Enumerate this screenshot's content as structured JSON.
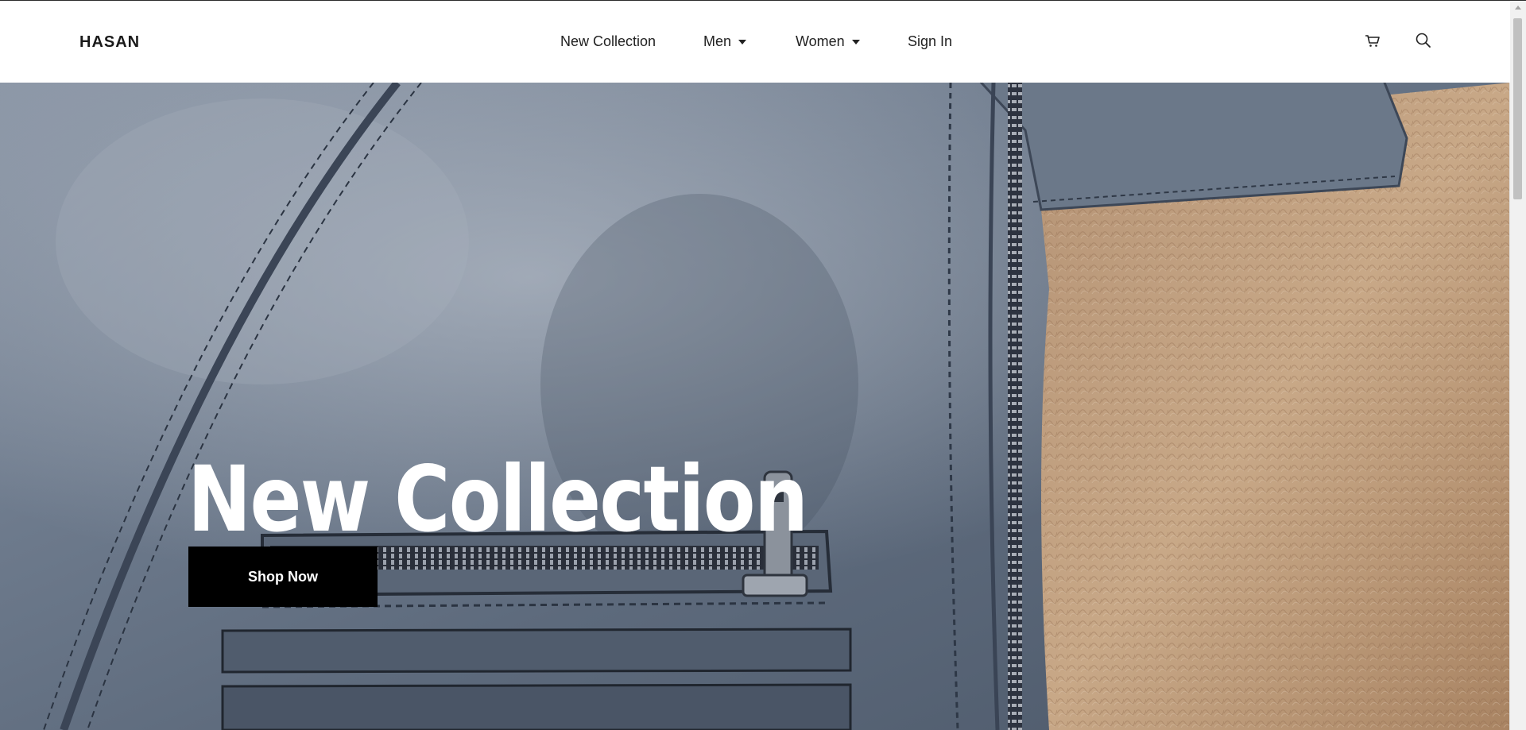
{
  "brand": {
    "logo_text": "HASAN"
  },
  "nav": {
    "links": [
      {
        "label": "New Collection",
        "has_dropdown": false
      },
      {
        "label": "Men",
        "has_dropdown": true
      },
      {
        "label": "Women",
        "has_dropdown": true
      },
      {
        "label": "Sign In",
        "has_dropdown": false
      }
    ],
    "icons": [
      "cart-icon",
      "search-icon"
    ]
  },
  "hero": {
    "title": "New Collection",
    "cta_label": "Shop Now",
    "image_subject": "leather-jacket-with-zipper-and-fur-lining"
  },
  "colors": {
    "cta_background": "#000000",
    "cta_text": "#ffffff",
    "title_text": "#ffffff",
    "navbar_background": "#ffffff"
  }
}
